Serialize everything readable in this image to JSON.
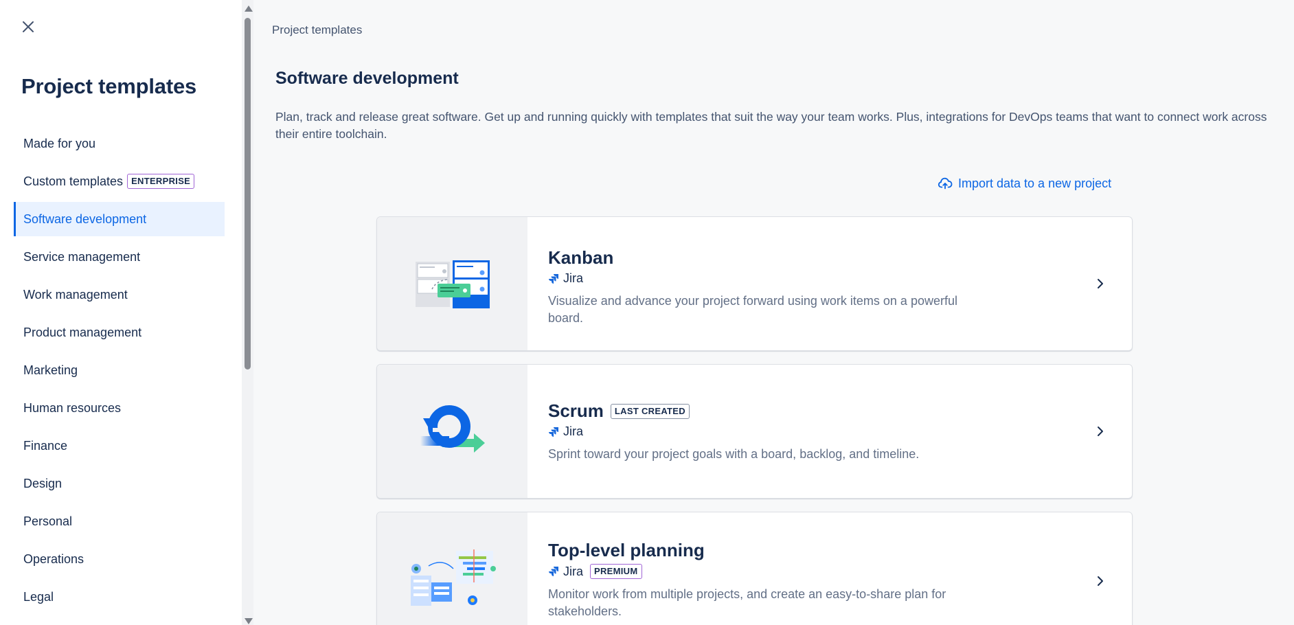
{
  "sidebar": {
    "title": "Project templates",
    "items": [
      {
        "label": "Made for you"
      },
      {
        "label": "Custom templates",
        "badge": "ENTERPRISE"
      },
      {
        "label": "Software development",
        "active": true
      },
      {
        "label": "Service management"
      },
      {
        "label": "Work management"
      },
      {
        "label": "Product management"
      },
      {
        "label": "Marketing"
      },
      {
        "label": "Human resources"
      },
      {
        "label": "Finance"
      },
      {
        "label": "Design"
      },
      {
        "label": "Personal"
      },
      {
        "label": "Operations"
      },
      {
        "label": "Legal"
      }
    ]
  },
  "main": {
    "breadcrumb": "Project templates",
    "title": "Software development",
    "description": "Plan, track and release great software. Get up and running quickly with templates that suit the way your team works. Plus, integrations for DevOps teams that want to connect work across their entire toolchain.",
    "import_link": "Import data to a new project",
    "cards": [
      {
        "title": "Kanban",
        "product": "Jira",
        "description": "Visualize and advance your project forward using work items on a powerful board."
      },
      {
        "title": "Scrum",
        "title_badge": "LAST CREATED",
        "product": "Jira",
        "description": "Sprint toward your project goals with a board, backlog, and timeline."
      },
      {
        "title": "Top-level planning",
        "product": "Jira",
        "product_badge": "PREMIUM",
        "description": "Monitor work from multiple projects, and create an easy-to-share plan for stakeholders."
      }
    ]
  },
  "colors": {
    "accent": "#0c66e4",
    "active_bg": "#e9f2ff",
    "text": "#172b4d",
    "subtle_text": "#44546f",
    "enterprise_border": "#a064d5"
  }
}
